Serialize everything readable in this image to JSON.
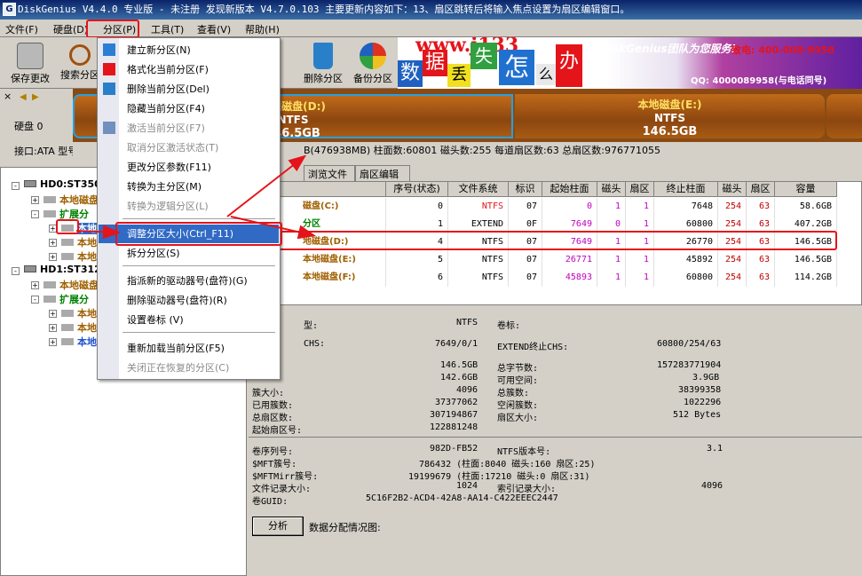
{
  "window": {
    "title": "DiskGenius V4.4.0 专业版 - 未注册   发现新版本 V4.7.0.103 主要更新内容如下：13、扇区跳转后将输入焦点设置为扇区编辑窗口。"
  },
  "menubar": {
    "items": [
      "文件(F)",
      "硬盘(D)",
      "分区(P)",
      "工具(T)",
      "查看(V)",
      "帮助(H)"
    ]
  },
  "toolbar": {
    "save": "保存更改",
    "search": "搜索分区",
    "delete": "删除分区",
    "backup": "备份分区"
  },
  "banner": {
    "site": "www.j133",
    "chars": [
      "数",
      "据",
      "丢",
      "失",
      "怎",
      "么",
      "办"
    ],
    "team": "DiskGenius团队为您服务!",
    "phone": "致电: 400-008-9958",
    "qq": "QQ: 4000089958(与电话同号)"
  },
  "disk": {
    "label": "硬盘 0",
    "iface": "接口:ATA  型号:S",
    "info": "B(476938MB)  柱面数:60801  磁头数:255  每道扇区数:63  总扇区数:976771055"
  },
  "diskmap": [
    {
      "name": "本地磁盘(D:)",
      "fs": "NTFS",
      "size": "146.5GB"
    },
    {
      "name": "本地磁盘(E:)",
      "fs": "NTFS",
      "size": "146.5GB"
    }
  ],
  "tree": {
    "hd0": "HD0:ST350",
    "part_local1": "本地磁盘",
    "ext1": "扩展分",
    "d": "本地",
    "e": "本地",
    "f": "本地",
    "hd1": "HD1:ST312",
    "p2": "本地磁盘",
    "ext2": "扩展分",
    "g": "本地",
    "h": "本地",
    "i": "本地"
  },
  "tabs": [
    "浏览文件",
    "扇区编辑"
  ],
  "table": {
    "headers": [
      "序号(状态)",
      "文件系统",
      "标识",
      "起始柱面",
      "磁头",
      "扇区",
      "终止柱面",
      "磁头",
      "扇区",
      "容量"
    ],
    "rows": [
      {
        "name": "磁盘(C:)",
        "num": "0",
        "fs": "NTFS",
        "id": "07",
        "sc": "0",
        "sh": "1",
        "ss": "1",
        "ec": "7648",
        "eh": "254",
        "es": "63",
        "cap": "58.6GB"
      },
      {
        "name": "分区",
        "num": "1",
        "fs": "EXTEND",
        "id": "0F",
        "sc": "7649",
        "sh": "0",
        "ss": "1",
        "ec": "60800",
        "eh": "254",
        "es": "63",
        "cap": "407.2GB"
      },
      {
        "name": "地磁盘(D:)",
        "num": "4",
        "fs": "NTFS",
        "id": "07",
        "sc": "7649",
        "sh": "1",
        "ss": "1",
        "ec": "26770",
        "eh": "254",
        "es": "63",
        "cap": "146.5GB"
      },
      {
        "name": "本地磁盘(E:)",
        "num": "5",
        "fs": "NTFS",
        "id": "07",
        "sc": "26771",
        "sh": "1",
        "ss": "1",
        "ec": "45892",
        "eh": "254",
        "es": "63",
        "cap": "146.5GB"
      },
      {
        "name": "本地磁盘(F:)",
        "num": "6",
        "fs": "NTFS",
        "id": "07",
        "sc": "45893",
        "sh": "1",
        "ss": "1",
        "ec": "60800",
        "eh": "254",
        "es": "63",
        "cap": "114.2GB"
      }
    ]
  },
  "details": {
    "type_label": "型:",
    "type_val": "NTFS",
    "vol_label": "卷标:",
    "chs_label": "CHS:",
    "chs_val": "7649/0/1",
    "ext_label": "EXTEND终止CHS:",
    "ext_val": "60800/254/63",
    "total_val": "146.5GB",
    "total_bytes_label": "总字节数:",
    "total_bytes": "157283771904",
    "used_val": "142.6GB",
    "free_label": "可用空间:",
    "free_val": "3.9GB",
    "cluster_label": "簇大小:",
    "cluster_val": "4096",
    "clusters_label": "总簇数:",
    "clusters_val": "38399358",
    "used_clusters_label": "已用簇数:",
    "used_clusters_val": "37377062",
    "free_clusters_label": "空闲簇数:",
    "free_clusters_val": "1022296",
    "total_sectors_label": "总扇区数:",
    "total_sectors_val": "307194867",
    "sector_size_label": "扇区大小:",
    "sector_size_val": "512 Bytes",
    "start_sector_label": "起始扇区号:",
    "start_sector_val": "122881248",
    "serial_label": "卷序列号:",
    "serial_val": "982D-FB52",
    "ntfs_label": "NTFS版本号:",
    "ntfs_val": "3.1",
    "mft_label": "$MFT簇号:",
    "mft_val": "786432 (柱面:8040 磁头:160 扇区:25)",
    "mftmirr_label": "$MFTMirr簇号:",
    "mftmirr_val": "19199679 (柱面:17210 磁头:0 扇区:31)",
    "record_label": "文件记录大小:",
    "record_val": "1024",
    "index_label": "索引记录大小:",
    "index_val": "4096",
    "guid_label": "卷GUID:",
    "guid_val": "5C16F2B2-ACD4-42A8-AA14-C422EEEC2447",
    "analyze_btn": "分析",
    "alloc_label": "数据分配情况图:"
  },
  "menu": {
    "items": [
      {
        "label": "建立新分区(N)",
        "enabled": true
      },
      {
        "label": "格式化当前分区(F)",
        "enabled": true
      },
      {
        "label": "删除当前分区(Del)",
        "enabled": true
      },
      {
        "label": "隐藏当前分区(F4)",
        "enabled": true
      },
      {
        "label": "激活当前分区(F7)",
        "enabled": false
      },
      {
        "label": "取消分区激活状态(T)",
        "enabled": false
      },
      {
        "label": "更改分区参数(F11)",
        "enabled": true
      },
      {
        "label": "转换为主分区(M)",
        "enabled": true
      },
      {
        "label": "转换为逻辑分区(L)",
        "enabled": false
      },
      {
        "label": "调整分区大小(Ctrl_F11)",
        "enabled": true
      },
      {
        "label": "拆分分区(S)",
        "enabled": true
      },
      {
        "label": "指派新的驱动器号(盘符)(G)",
        "enabled": true
      },
      {
        "label": "删除驱动器号(盘符)(R)",
        "enabled": true
      },
      {
        "label": "设置卷标 (V)",
        "enabled": true
      },
      {
        "label": "重新加载当前分区(F5)",
        "enabled": true
      },
      {
        "label": "关闭正在恢复的分区(C)",
        "enabled": false
      }
    ]
  },
  "colors": {
    "accent_red": "#e4141b",
    "partition_brown": "#8c4610",
    "selection": "#316ac5"
  }
}
